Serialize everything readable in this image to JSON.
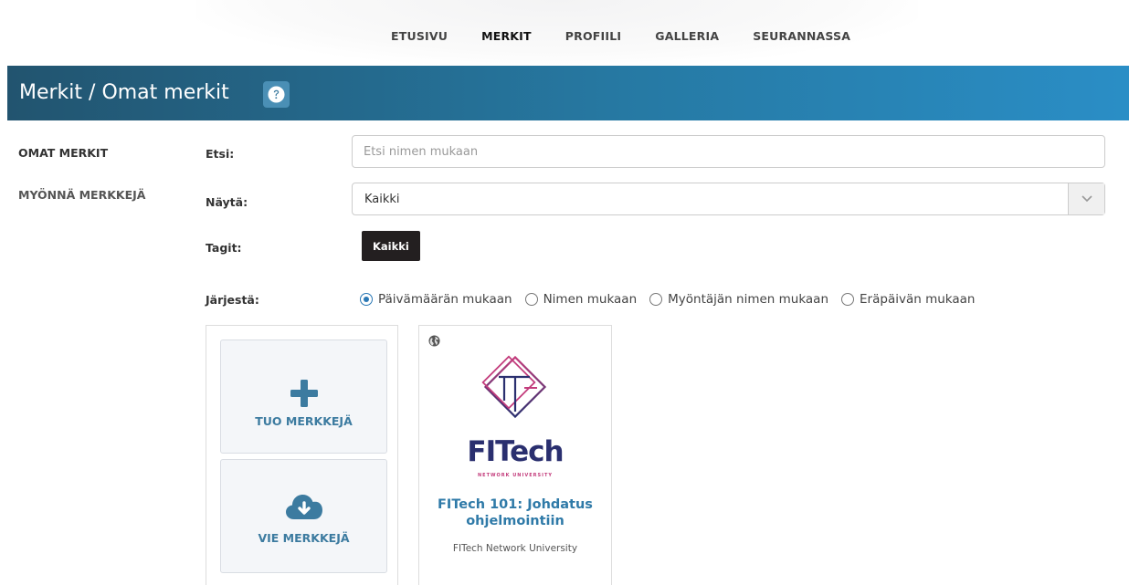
{
  "nav": {
    "items": [
      {
        "label": "ETUSIVU",
        "active": false
      },
      {
        "label": "MERKIT",
        "active": true
      },
      {
        "label": "PROFIILI",
        "active": false
      },
      {
        "label": "GALLERIA",
        "active": false
      },
      {
        "label": "SEURANNASSA",
        "active": false
      }
    ]
  },
  "header": {
    "title": "Merkit / Omat merkit",
    "help_icon": "question-circle-icon",
    "gradient_start": "#22546f",
    "gradient_end": "#2a8ec6"
  },
  "sidebar": {
    "items": [
      {
        "label": "OMAT MERKIT",
        "active": true
      },
      {
        "label": "MYÖNNÄ MERKKEJÄ",
        "active": false
      }
    ]
  },
  "filters": {
    "search_label": "Etsi:",
    "search_placeholder": "Etsi nimen mukaan",
    "search_value": "",
    "show_label": "Näytä:",
    "show_value": "Kaikki",
    "tags_label": "Tagit:",
    "tag_button": "Kaikki",
    "sort_label": "Järjestä:",
    "sort_options": [
      {
        "label": "Päivämäärän mukaan",
        "checked": true
      },
      {
        "label": "Nimen mukaan",
        "checked": false
      },
      {
        "label": "Myöntäjän nimen mukaan",
        "checked": false
      },
      {
        "label": "Eräpäivän mukaan",
        "checked": false
      }
    ],
    "accent_color": "#2a78b5"
  },
  "actions": {
    "import_label": "TUO MERKKEJÄ",
    "import_icon": "plus-icon",
    "export_label": "VIE MERKKEJÄ",
    "export_icon": "cloud-download-icon",
    "icon_color": "#3c7ba0"
  },
  "badge": {
    "visibility_icon": "globe-icon",
    "logo_text": "FITech",
    "logo_subtext": "NETWORK UNIVERSITY",
    "title": "FITech 101: Johdatus ohjelmointiin",
    "issuer": "FITech Network University",
    "title_color": "#2f7aa8",
    "logo_color": "#2a2f6f",
    "logo_accent": "#c33c7c"
  }
}
